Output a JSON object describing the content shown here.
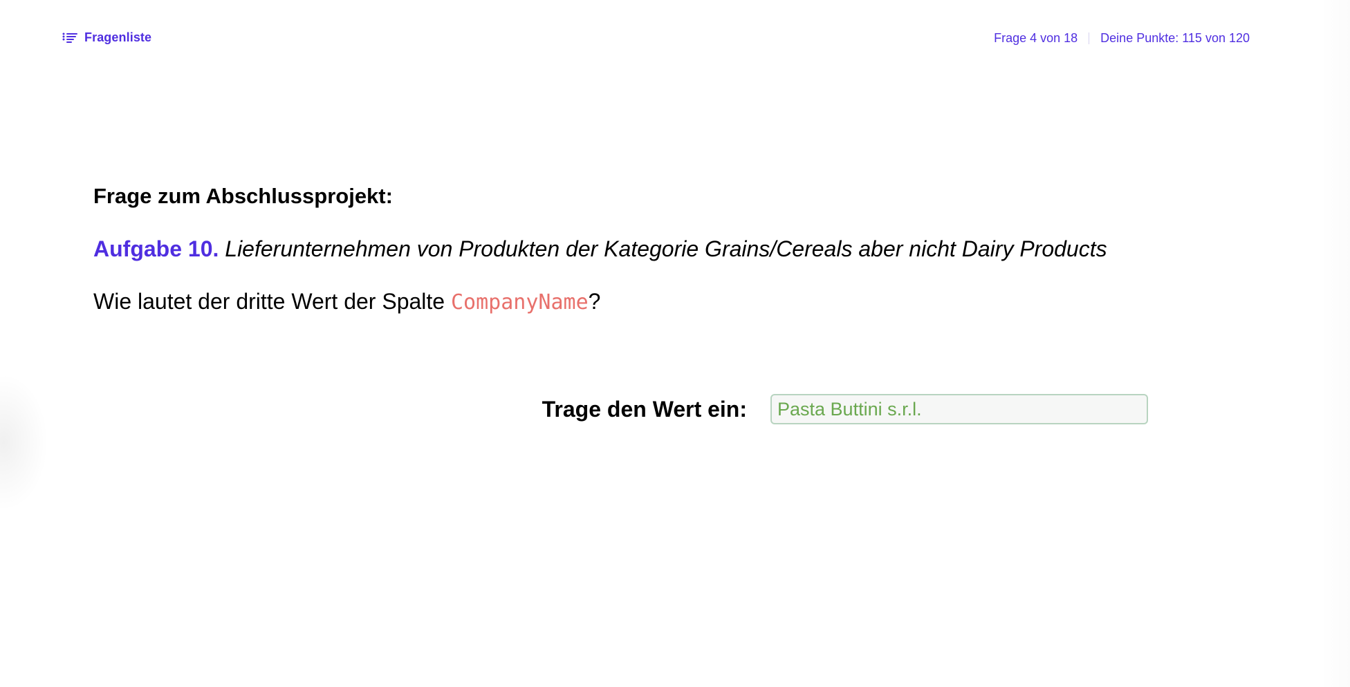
{
  "header": {
    "question_list_label": "Fragenliste",
    "question_list_icon": "list-icon",
    "progress_text": "Frage 4 von 18",
    "score_text": "Deine Punkte: 115 von 120"
  },
  "main": {
    "section_title": "Frage zum Abschlussprojekt:",
    "task_label": "Aufgabe 10.",
    "task_text": "Lieferunternehmen von Produkten der Kategorie Grains/Cereals aber nicht Dairy Products",
    "question_prefix": "Wie lautet der dritte Wert der Spalte ",
    "question_column": "CompanyName",
    "question_suffix": "?"
  },
  "answer": {
    "label": "Trage den Wert ein:",
    "value": "Pasta Buttini s.r.l."
  },
  "colors": {
    "accent": "#4f2ee0",
    "code": "#e8706b",
    "answer_text": "#6aa84f"
  }
}
